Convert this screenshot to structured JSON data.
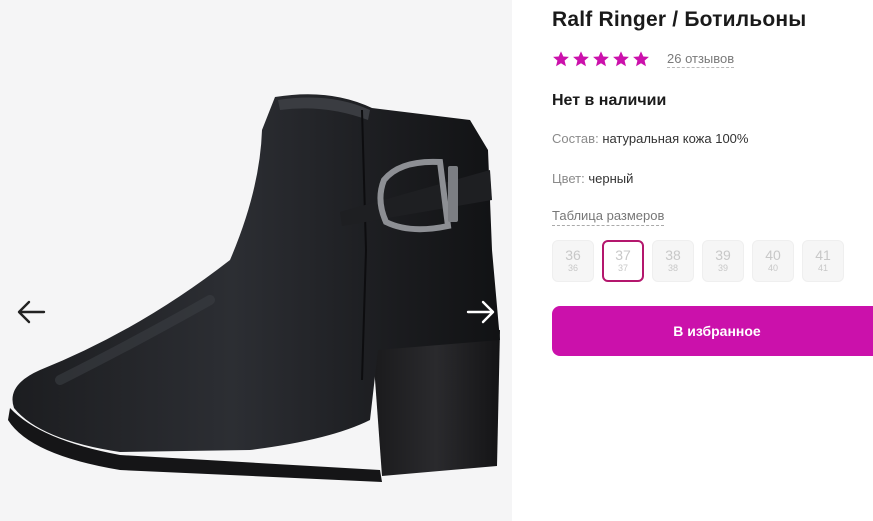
{
  "product": {
    "title": "Ralf Ringer / Ботильоны",
    "rating": 5,
    "reviews_label": "26 отзывов",
    "stock_status": "Нет в наличии",
    "composition_label": "Состав:",
    "composition_value": "натуральная кожа 100%",
    "color_label": "Цвет:",
    "color_value": "черный",
    "size_table_link": "Таблица размеров",
    "sizes": [
      {
        "label": "36",
        "sub": "36",
        "selected": false
      },
      {
        "label": "37",
        "sub": "37",
        "selected": true
      },
      {
        "label": "38",
        "sub": "38",
        "selected": false
      },
      {
        "label": "39",
        "sub": "39",
        "selected": false
      },
      {
        "label": "40",
        "sub": "40",
        "selected": false
      },
      {
        "label": "41",
        "sub": "41",
        "selected": false
      }
    ],
    "favorite_button": "В избранное"
  },
  "gallery": {
    "prev_icon": "arrow-left-icon",
    "next_icon": "arrow-right-icon"
  },
  "colors": {
    "accent": "#cb11ab",
    "star": "#cb11ab",
    "selected_size_border": "#b4176d"
  }
}
